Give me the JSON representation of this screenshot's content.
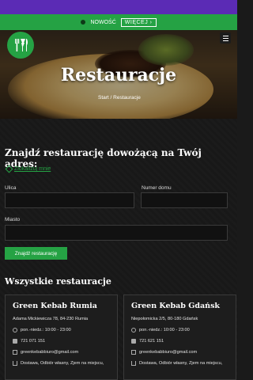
{
  "notice": {
    "badge": "NOWOŚĆ",
    "more_label": "WIĘCEJ ›"
  },
  "hero": {
    "title": "Restauracje",
    "crumb_home": "Start",
    "crumb_sep": "/",
    "crumb_current": "Restauracje"
  },
  "finder": {
    "heading": "Znajdź restaurację dowożącą na Twój adres:",
    "locate_label": "Zlokalizuj mnie",
    "street_label": "Ulica",
    "house_label": "Numer domu",
    "city_label": "Miasto",
    "street_value": "",
    "house_value": "",
    "city_value": "",
    "submit_label": "Znajdź restaurację"
  },
  "all": {
    "heading": "Wszystkie restauracje",
    "restaurants": [
      {
        "name": "Green Kebab Rumia",
        "address": "Adama Mickiewicza 78, 84-230 Rumia",
        "hours": "pon.-niedz.: 10:00 - 23:00",
        "phone": "721 071 151",
        "email": "greenkebabbiuro@gmail.com",
        "delivery": "Dostawa, Odbiór własny, Zjem na miejscu,"
      },
      {
        "name": "Green Kebab Gdańsk",
        "address": "Niepołomicka 2/5, 80-180 Gdańsk",
        "hours": "pon.-niedz.: 10:00 - 23:00",
        "phone": "721 621 151",
        "email": "greenkebabbiuro@gmail.com",
        "delivery": "Dostawa, Odbiór własny, Zjem na miejscu,"
      }
    ]
  },
  "colors": {
    "brand_green": "#25a244",
    "top_purple": "#5b2bb5"
  },
  "icons": {
    "logo": "kebab-fork-knife-icon",
    "menu": "hamburger-icon",
    "locate": "location-pin-icon"
  }
}
